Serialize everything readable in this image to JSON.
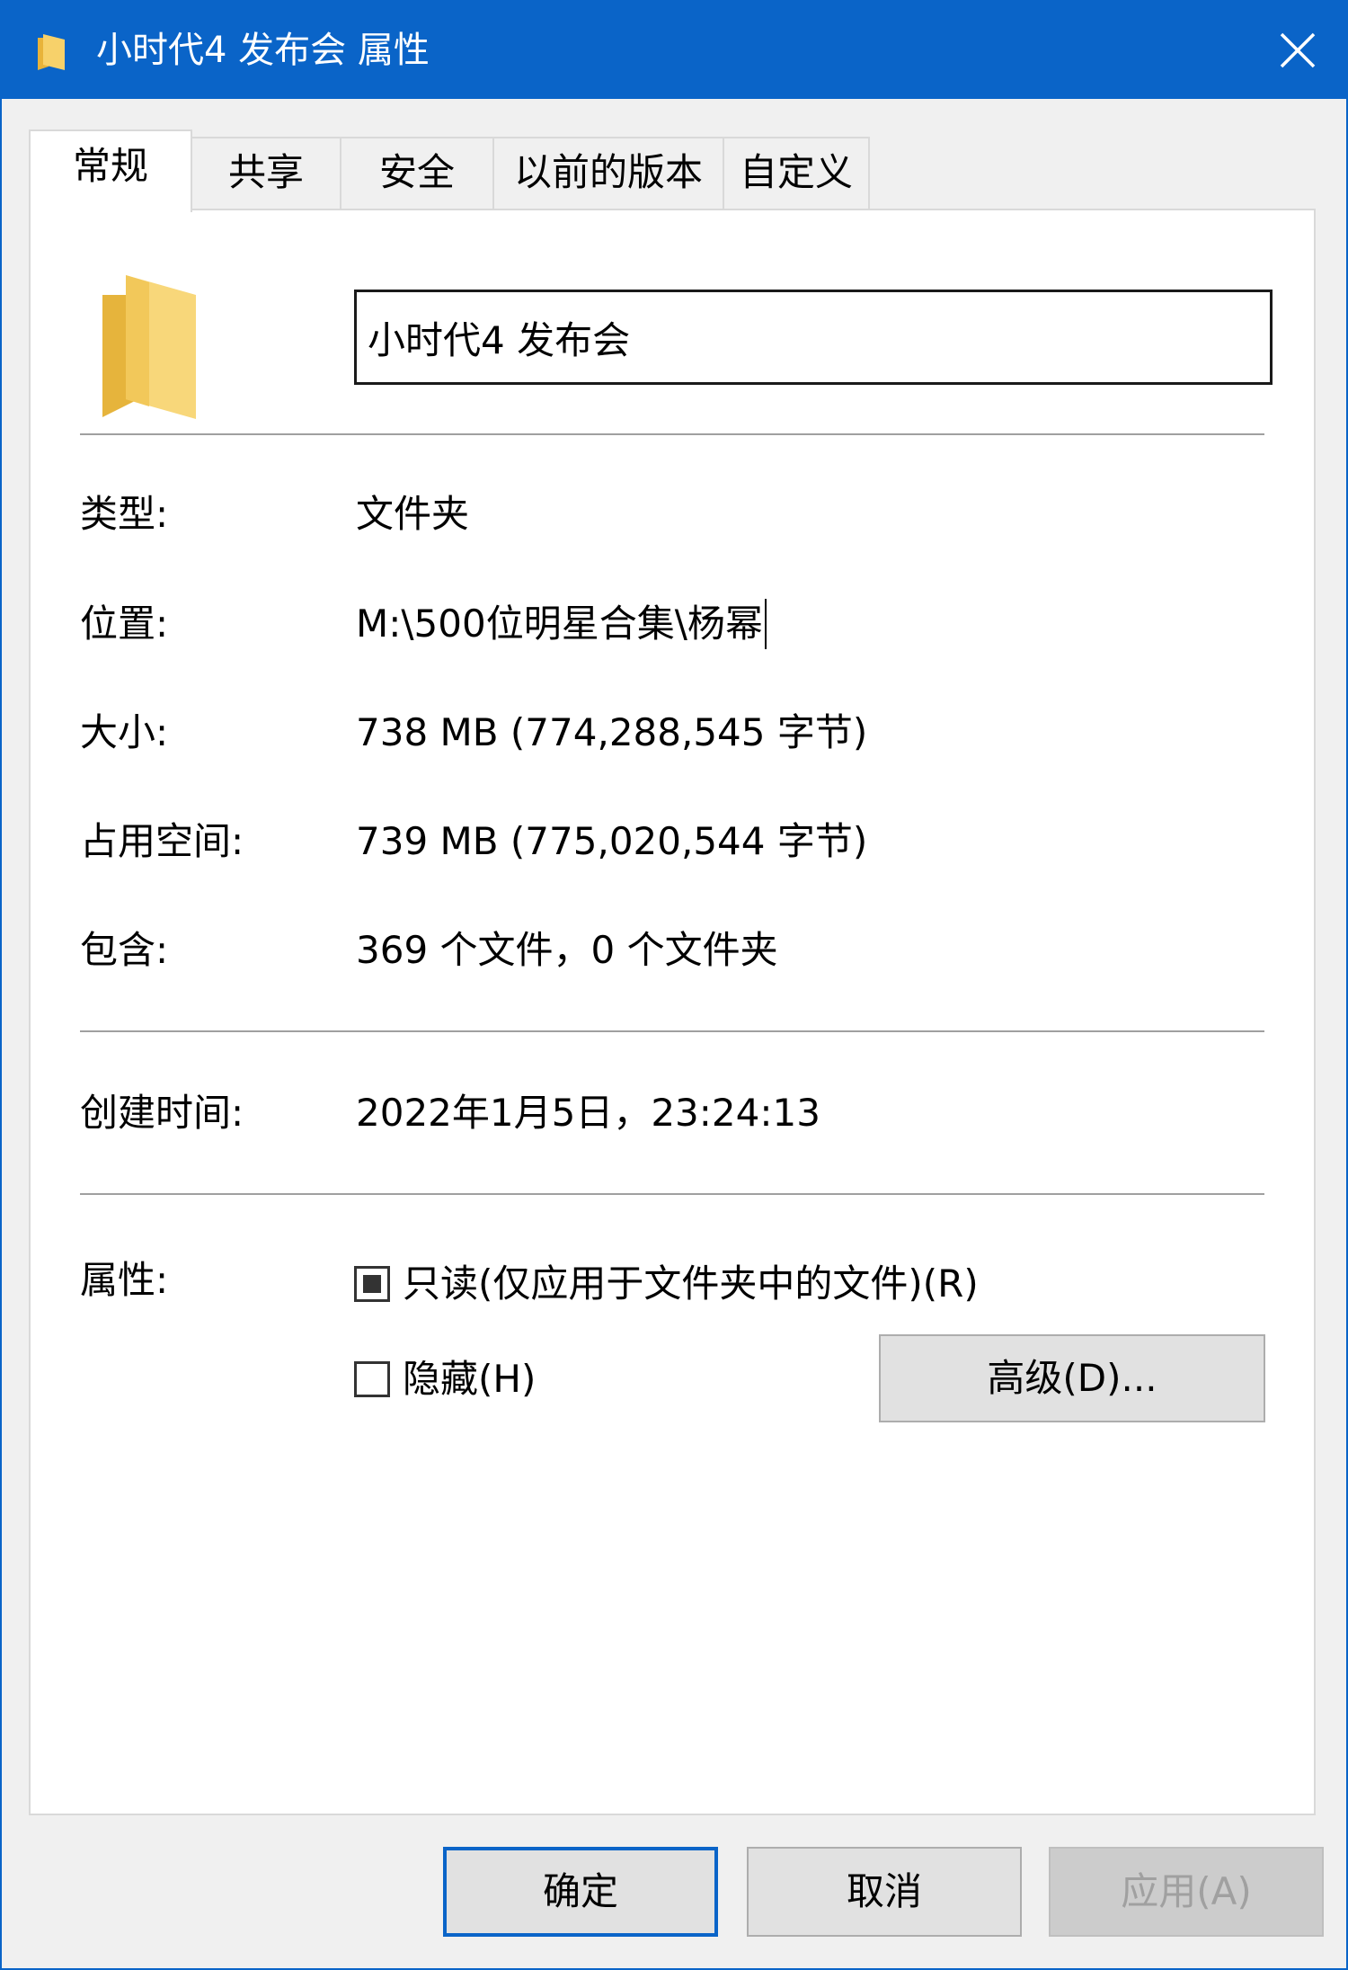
{
  "window": {
    "title": "小时代4 发布会 属性"
  },
  "tabs": [
    {
      "label": "常规",
      "active": true
    },
    {
      "label": "共享",
      "active": false
    },
    {
      "label": "安全",
      "active": false
    },
    {
      "label": "以前的版本",
      "active": false
    },
    {
      "label": "自定义",
      "active": false
    }
  ],
  "general": {
    "folder_name": "小时代4 发布会",
    "type_label": "类型:",
    "type_value": "文件夹",
    "location_label": "位置:",
    "location_value": "M:\\500位明星合集\\杨幂",
    "size_label": "大小:",
    "size_value": "738 MB (774,288,545 字节)",
    "disk_size_label": "占用空间:",
    "disk_size_value": "739 MB (775,020,544 字节)",
    "contains_label": "包含:",
    "contains_value": "369 个文件，0 个文件夹",
    "created_label": "创建时间:",
    "created_value": "2022年1月5日，23:24:13",
    "attributes_label": "属性:",
    "readonly_label": "只读(仅应用于文件夹中的文件)(R)",
    "readonly_state": "indeterminate",
    "hidden_label": "隐藏(H)",
    "hidden_state": "unchecked",
    "advanced_button": "高级(D)..."
  },
  "footer": {
    "ok_label": "确定",
    "cancel_label": "取消",
    "apply_label": "应用(A)"
  },
  "colors": {
    "titlebar": "#0a64c8",
    "folder": "#f5c94c"
  }
}
